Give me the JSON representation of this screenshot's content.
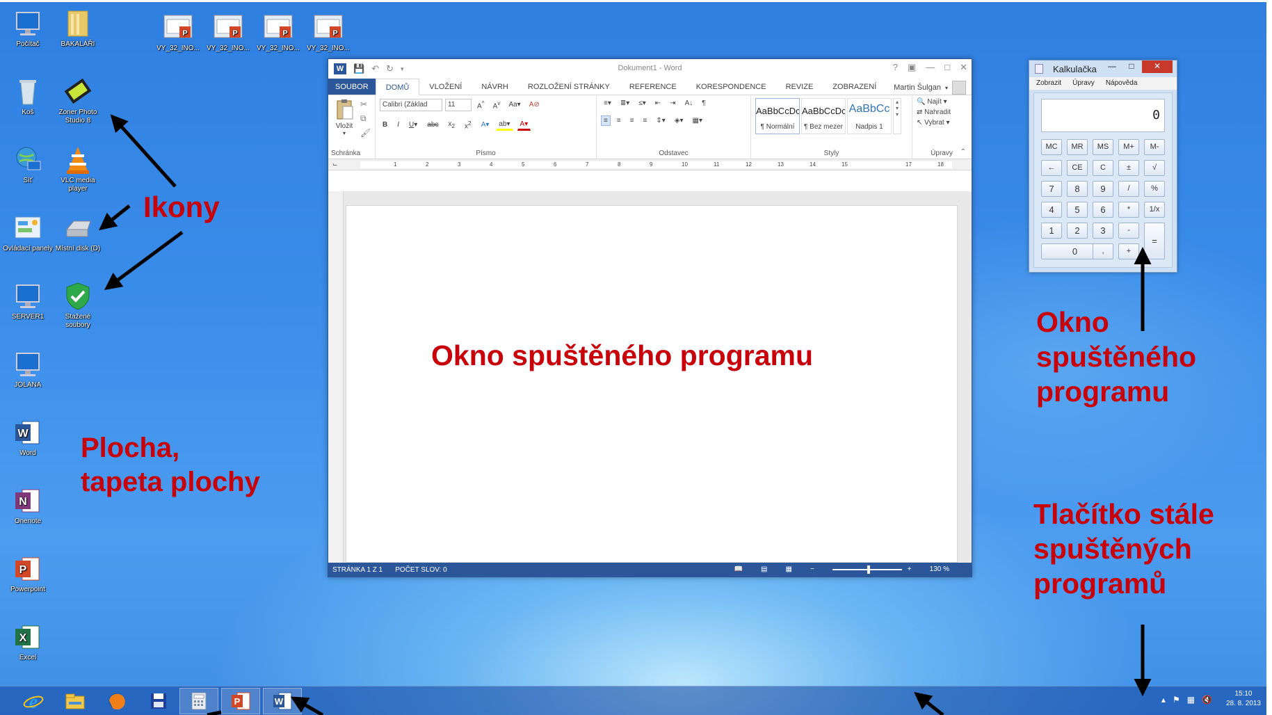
{
  "desktop_icons": [
    {
      "label": "Počítač",
      "icon": "computer-icon"
    },
    {
      "label": "BAKALÁŘI",
      "icon": "folder-icon"
    },
    {
      "label": "Koš",
      "icon": "recycle-bin-icon"
    },
    {
      "label": "Zoner Photo Studio 8",
      "icon": "zoner-photo-icon"
    },
    {
      "label": "Síť",
      "icon": "network-icon"
    },
    {
      "label": "VLC media player",
      "icon": "vlc-icon"
    },
    {
      "label": "Ovládací panely",
      "icon": "control-panel-icon"
    },
    {
      "label": "Místní disk (D)",
      "icon": "disk-icon"
    },
    {
      "label": "SERVER1",
      "icon": "computer-icon"
    },
    {
      "label": "Stažené soubory",
      "icon": "shield-check-icon"
    },
    {
      "label": "JOLANA",
      "icon": "computer-icon"
    },
    {
      "label": "Word",
      "icon": "word-icon"
    },
    {
      "label": "Onenote",
      "icon": "onenote-icon"
    },
    {
      "label": "Powerpoint",
      "icon": "powerpoint-icon"
    },
    {
      "label": "Excel",
      "icon": "excel-icon"
    },
    {
      "label": "VY_32_INO...",
      "icon": "pptx-file-icon"
    },
    {
      "label": "VY_32_INO...",
      "icon": "pptx-file-icon"
    },
    {
      "label": "VY_32_INO...",
      "icon": "pptx-file-icon"
    },
    {
      "label": "VY_32_INO...",
      "icon": "pptx-file-icon"
    }
  ],
  "annotations": {
    "icons": "Ikony",
    "desktop": "Plocha,\ntapeta plochy",
    "window_center": "Okno spuštěného programu",
    "window_right": "Okno\nspuštěného\nprogramu",
    "taskbar": "Tlačítko stále\nspuštěných\nprogramů"
  },
  "word": {
    "title": "Dokument1 - Word",
    "tabs": [
      "SOUBOR",
      "DOMŮ",
      "VLOŽENÍ",
      "NÁVRH",
      "ROZLOŽENÍ STRÁNKY",
      "REFERENCE",
      "KORESPONDENCE",
      "REVIZE",
      "ZOBRAZENÍ"
    ],
    "active_tab": "DOMŮ",
    "user": "Martin Šulgan",
    "font_name": "Calibri (Základ",
    "font_size": "11",
    "paste_label": "Vložit",
    "groups": [
      "Schránka",
      "Písmo",
      "Odstavec",
      "Styly",
      "Úpravy"
    ],
    "styles": [
      {
        "sample": "AaBbCcDc",
        "name": "¶ Normální"
      },
      {
        "sample": "AaBbCcDc",
        "name": "¶ Bez mezer"
      },
      {
        "sample": "AaBbCc",
        "name": "Nadpis 1"
      }
    ],
    "editing": [
      "Najít",
      "Nahradit",
      "Vybrat"
    ],
    "ruler_marks": [
      "1",
      "2",
      "3",
      "4",
      "5",
      "6",
      "7",
      "8",
      "9",
      "10",
      "11",
      "12",
      "13",
      "14",
      "15",
      "17",
      "18"
    ],
    "status_page": "STRÁNKA 1 Z 1",
    "status_words": "POČET SLOV: 0",
    "zoom": "130 %"
  },
  "calculator": {
    "title": "Kalkulačka",
    "menu": [
      "Zobrazit",
      "Úpravy",
      "Nápověda"
    ],
    "display": "0",
    "row1": [
      "MC",
      "MR",
      "MS",
      "M+",
      "M-"
    ],
    "row2": [
      "←",
      "CE",
      "C",
      "±",
      "√"
    ],
    "row3": [
      "7",
      "8",
      "9",
      "/",
      "%"
    ],
    "row4": [
      "4",
      "5",
      "6",
      "*",
      "1/x"
    ],
    "row5": [
      "1",
      "2",
      "3",
      "-"
    ],
    "row6": [
      "0",
      ",",
      "+"
    ],
    "equals": "="
  },
  "taskbar": {
    "apps": [
      "internet-explorer-icon",
      "file-explorer-icon",
      "firefox-icon",
      "save-disk-icon",
      "calculator-icon",
      "powerpoint-icon",
      "word-icon"
    ],
    "time": "15:10",
    "date": "28. 8. 2013"
  }
}
